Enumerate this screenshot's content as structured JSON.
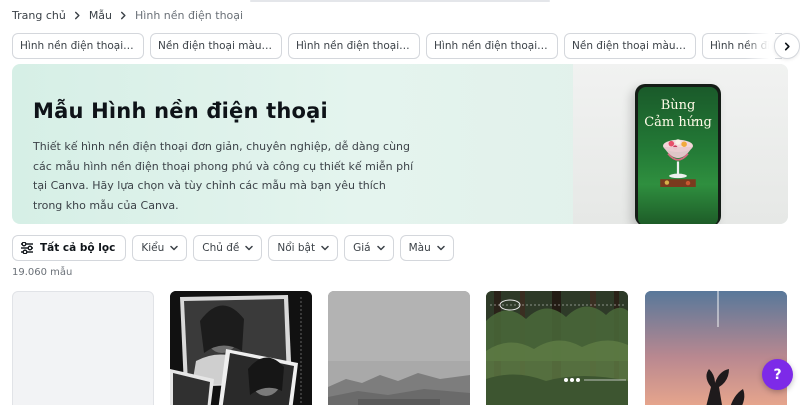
{
  "breadcrumb": {
    "items": [
      "Trang chủ",
      "Mẫu",
      "Hình nền điện thoại"
    ]
  },
  "chips": [
    "Hình nền điện thoại Ngày...",
    "Nền điện thoại màu kem",
    "Hình nền điện thoại nhiề...",
    "Hình nền điện thoại tối gi...",
    "Nền điện thoại màu trun...",
    "Hình nền điện thoại"
  ],
  "hero": {
    "title": "Mẫu Hình nền điện thoại",
    "description": "Thiết kế hình nền điện thoại đơn giản, chuyên nghiệp, dễ dàng cùng các mẫu hình nền điện thoại phong phú và công cụ thiết kế miễn phí tại Canva. Hãy lựa chọn và tùy chỉnh các mẫu mà bạn yêu thích trong kho mẫu của Canva.",
    "phone_line1": "Bùng",
    "phone_line2": "Cảm hứng"
  },
  "filters": {
    "all_label": "Tất cả bộ lọc",
    "dropdowns": [
      "Kiểu",
      "Chủ đề",
      "Nổi bật",
      "Giá",
      "Màu"
    ]
  },
  "results_count": "19.060 mẫu",
  "help_label": "?",
  "colors": {
    "accent": "#7d2ae8",
    "hero_bg": "#d6efe6",
    "text_primary": "#0e1318",
    "text_secondary": "#3c4248"
  },
  "icons": {
    "breadcrumb_separator": "chevron-right-icon",
    "chips_next": "chevron-right-icon",
    "all_filters": "sliders-icon",
    "dropdown": "chevron-down-icon"
  }
}
